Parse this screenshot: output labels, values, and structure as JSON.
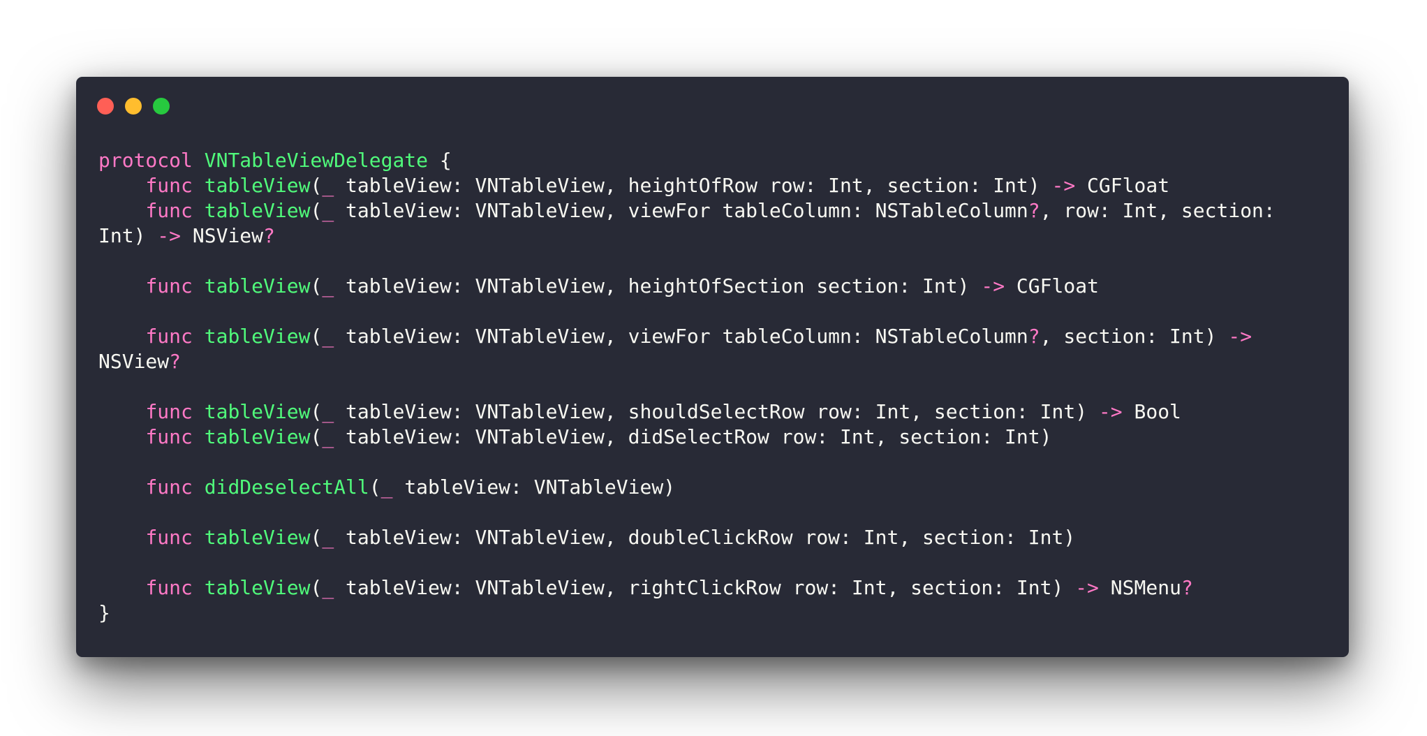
{
  "window": {
    "controls": [
      {
        "name": "close",
        "color": "#ff5f56"
      },
      {
        "name": "minimize",
        "color": "#ffbd2e"
      },
      {
        "name": "zoom",
        "color": "#27c93f"
      }
    ]
  },
  "colors": {
    "background": "#282a36",
    "keyword": "#ff79c6",
    "function_name": "#50fa7b",
    "operator": "#ff79c6",
    "text": "#f8f8f2"
  },
  "code": {
    "language": "swift",
    "lines": [
      [
        {
          "t": "keyword",
          "v": "protocol"
        },
        {
          "t": "plain",
          "v": " "
        },
        {
          "t": "name",
          "v": "VNTableViewDelegate"
        },
        {
          "t": "plain",
          "v": " {"
        }
      ],
      [
        {
          "t": "plain",
          "v": "    "
        },
        {
          "t": "keyword",
          "v": "func"
        },
        {
          "t": "plain",
          "v": " "
        },
        {
          "t": "name",
          "v": "tableView"
        },
        {
          "t": "plain",
          "v": "("
        },
        {
          "t": "op",
          "v": "_"
        },
        {
          "t": "plain",
          "v": " tableView: VNTableView, heightOfRow row: Int, section: Int) "
        },
        {
          "t": "op",
          "v": "->"
        },
        {
          "t": "plain",
          "v": " CGFloat"
        }
      ],
      [
        {
          "t": "plain",
          "v": "    "
        },
        {
          "t": "keyword",
          "v": "func"
        },
        {
          "t": "plain",
          "v": " "
        },
        {
          "t": "name",
          "v": "tableView"
        },
        {
          "t": "plain",
          "v": "("
        },
        {
          "t": "op",
          "v": "_"
        },
        {
          "t": "plain",
          "v": " tableView: VNTableView, viewFor tableColumn: NSTableColumn"
        },
        {
          "t": "op",
          "v": "?"
        },
        {
          "t": "plain",
          "v": ", row: Int, section:"
        }
      ],
      [
        {
          "t": "plain",
          "v": "Int) "
        },
        {
          "t": "op",
          "v": "->"
        },
        {
          "t": "plain",
          "v": " NSView"
        },
        {
          "t": "op",
          "v": "?"
        }
      ],
      [],
      [
        {
          "t": "plain",
          "v": "    "
        },
        {
          "t": "keyword",
          "v": "func"
        },
        {
          "t": "plain",
          "v": " "
        },
        {
          "t": "name",
          "v": "tableView"
        },
        {
          "t": "plain",
          "v": "("
        },
        {
          "t": "op",
          "v": "_"
        },
        {
          "t": "plain",
          "v": " tableView: VNTableView, heightOfSection section: Int) "
        },
        {
          "t": "op",
          "v": "->"
        },
        {
          "t": "plain",
          "v": " CGFloat"
        }
      ],
      [],
      [
        {
          "t": "plain",
          "v": "    "
        },
        {
          "t": "keyword",
          "v": "func"
        },
        {
          "t": "plain",
          "v": " "
        },
        {
          "t": "name",
          "v": "tableView"
        },
        {
          "t": "plain",
          "v": "("
        },
        {
          "t": "op",
          "v": "_"
        },
        {
          "t": "plain",
          "v": " tableView: VNTableView, viewFor tableColumn: NSTableColumn"
        },
        {
          "t": "op",
          "v": "?"
        },
        {
          "t": "plain",
          "v": ", section: Int) "
        },
        {
          "t": "op",
          "v": "->"
        }
      ],
      [
        {
          "t": "plain",
          "v": "NSView"
        },
        {
          "t": "op",
          "v": "?"
        }
      ],
      [],
      [
        {
          "t": "plain",
          "v": "    "
        },
        {
          "t": "keyword",
          "v": "func"
        },
        {
          "t": "plain",
          "v": " "
        },
        {
          "t": "name",
          "v": "tableView"
        },
        {
          "t": "plain",
          "v": "("
        },
        {
          "t": "op",
          "v": "_"
        },
        {
          "t": "plain",
          "v": " tableView: VNTableView, shouldSelectRow row: Int, section: Int) "
        },
        {
          "t": "op",
          "v": "->"
        },
        {
          "t": "plain",
          "v": " Bool"
        }
      ],
      [
        {
          "t": "plain",
          "v": "    "
        },
        {
          "t": "keyword",
          "v": "func"
        },
        {
          "t": "plain",
          "v": " "
        },
        {
          "t": "name",
          "v": "tableView"
        },
        {
          "t": "plain",
          "v": "("
        },
        {
          "t": "op",
          "v": "_"
        },
        {
          "t": "plain",
          "v": " tableView: VNTableView, didSelectRow row: Int, section: Int)"
        }
      ],
      [],
      [
        {
          "t": "plain",
          "v": "    "
        },
        {
          "t": "keyword",
          "v": "func"
        },
        {
          "t": "plain",
          "v": " "
        },
        {
          "t": "name",
          "v": "didDeselectAll"
        },
        {
          "t": "plain",
          "v": "("
        },
        {
          "t": "op",
          "v": "_"
        },
        {
          "t": "plain",
          "v": " tableView: VNTableView)"
        }
      ],
      [],
      [
        {
          "t": "plain",
          "v": "    "
        },
        {
          "t": "keyword",
          "v": "func"
        },
        {
          "t": "plain",
          "v": " "
        },
        {
          "t": "name",
          "v": "tableView"
        },
        {
          "t": "plain",
          "v": "("
        },
        {
          "t": "op",
          "v": "_"
        },
        {
          "t": "plain",
          "v": " tableView: VNTableView, doubleClickRow row: Int, section: Int)"
        }
      ],
      [],
      [
        {
          "t": "plain",
          "v": "    "
        },
        {
          "t": "keyword",
          "v": "func"
        },
        {
          "t": "plain",
          "v": " "
        },
        {
          "t": "name",
          "v": "tableView"
        },
        {
          "t": "plain",
          "v": "("
        },
        {
          "t": "op",
          "v": "_"
        },
        {
          "t": "plain",
          "v": " tableView: VNTableView, rightClickRow row: Int, section: Int) "
        },
        {
          "t": "op",
          "v": "->"
        },
        {
          "t": "plain",
          "v": " NSMenu"
        },
        {
          "t": "op",
          "v": "?"
        }
      ],
      [
        {
          "t": "plain",
          "v": "}"
        }
      ]
    ]
  }
}
